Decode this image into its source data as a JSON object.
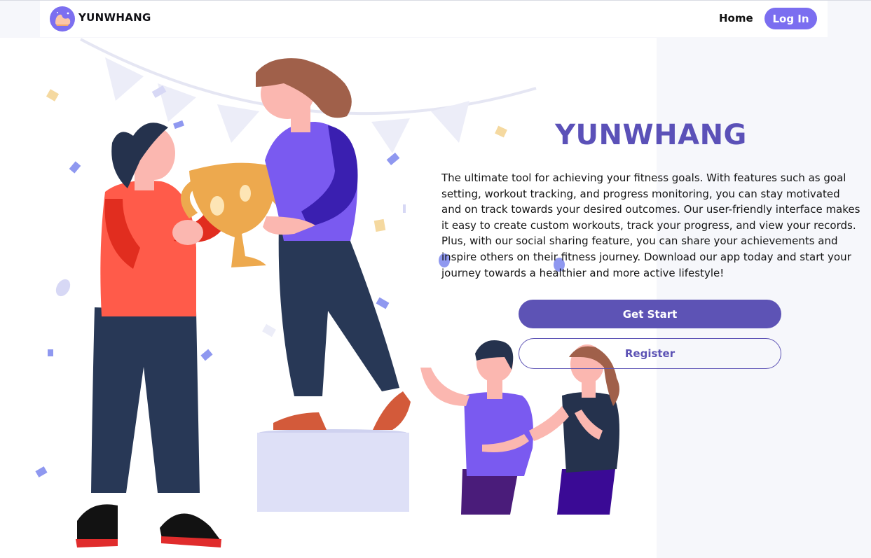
{
  "navbar": {
    "brand": "YUNWHANG",
    "home": "Home",
    "login": "Log In"
  },
  "hero": {
    "title": "YUNWHANG",
    "description": "The ultimate tool for achieving your fitness goals. With features such as goal setting, workout tracking, and progress monitoring, you can stay motivated and on track towards your desired outcomes. Our user-friendly interface makes it easy to create custom workouts, track your progress, and view your records. Plus, with our social sharing feature, you can share your achievements and inspire others on their fitness journey. Download our app today and start your journey towards a healthier and more active lifestyle!",
    "primary_button": "Get Start",
    "secondary_button": "Register"
  },
  "icons": {
    "logo": "flexed-arm-icon"
  },
  "colors": {
    "accent": "#7b6ef0",
    "title": "#5b51b8",
    "button": "#5d53b5",
    "background": "#f6f7fb"
  }
}
